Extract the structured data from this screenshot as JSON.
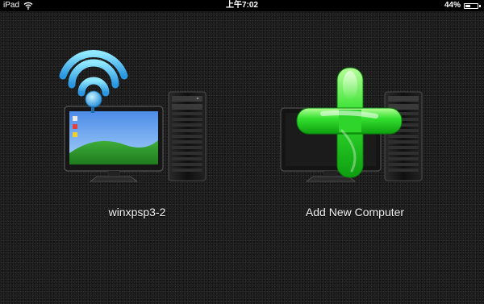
{
  "status_bar": {
    "device": "iPad",
    "time": "上午7:02",
    "battery": "44%",
    "battery_level": 0.44
  },
  "computers": [
    {
      "label": "winxpsp3-2",
      "icon": "connected-computer-icon"
    },
    {
      "label": "Add New Computer",
      "icon": "add-computer-icon"
    }
  ]
}
